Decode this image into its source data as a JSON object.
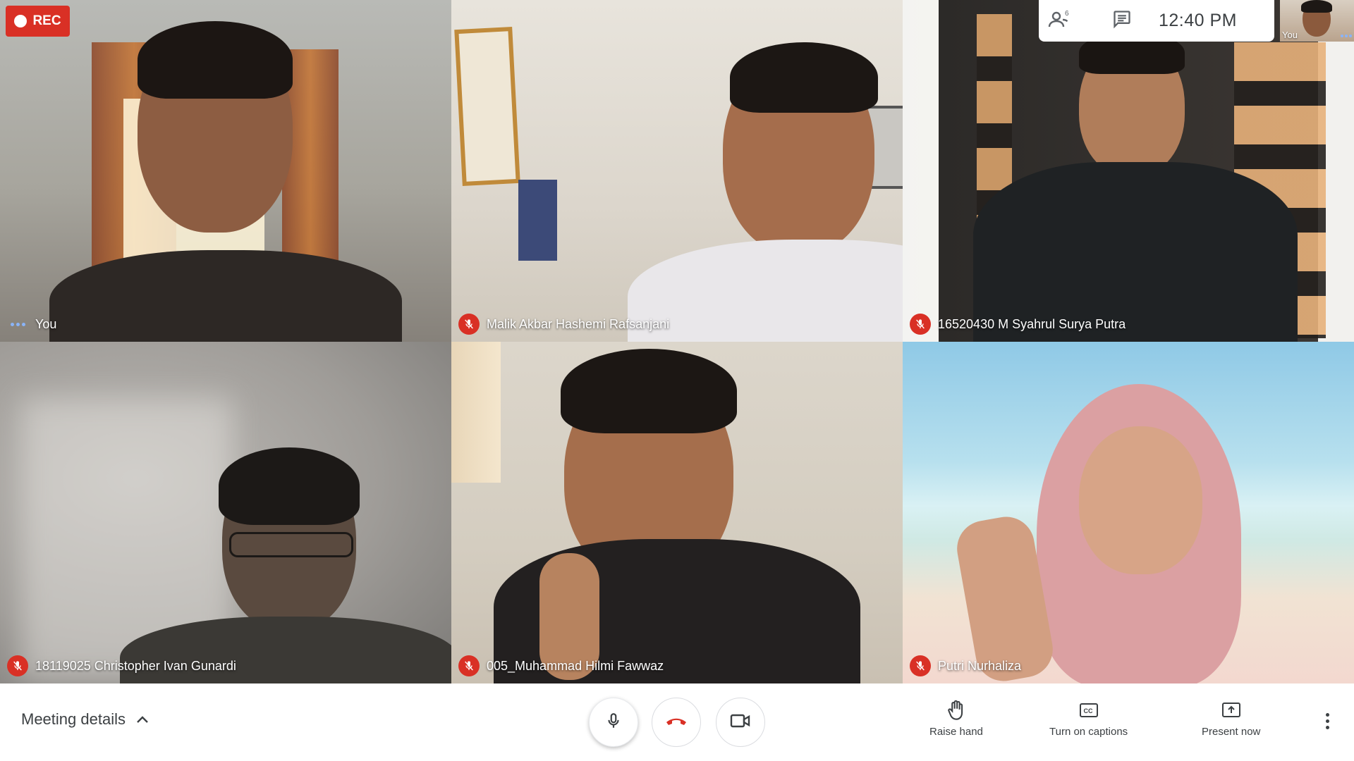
{
  "recording": {
    "label": "REC"
  },
  "topbar": {
    "time": "12:40 PM",
    "people_count": "6",
    "self_view_label": "You"
  },
  "participants": [
    {
      "name": "You",
      "muted": false
    },
    {
      "name": "Malik Akbar Hashemi Rafsanjani",
      "muted": true
    },
    {
      "name": "16520430 M Syahrul Surya Putra",
      "muted": true
    },
    {
      "name": "18119025 Christopher Ivan Gunardi",
      "muted": true
    },
    {
      "name": "005_Muhammad Hilmi Fawwaz",
      "muted": true
    },
    {
      "name": "Putri Nurhaliza",
      "muted": true
    }
  ],
  "bottom": {
    "meeting_details": "Meeting details",
    "actions": {
      "raise_hand": "Raise hand",
      "captions": "Turn on captions",
      "present": "Present now"
    }
  },
  "colors": {
    "mute_red": "#d93025",
    "accent_blue": "#8ab4f8",
    "text_dark": "#3c4043"
  },
  "icons": [
    "people-icon",
    "chat-icon",
    "mic-icon",
    "hang-up-icon",
    "camera-icon",
    "hand-icon",
    "captions-icon",
    "present-icon",
    "more-vert-icon",
    "chevron-up-icon",
    "mic-off-icon"
  ]
}
